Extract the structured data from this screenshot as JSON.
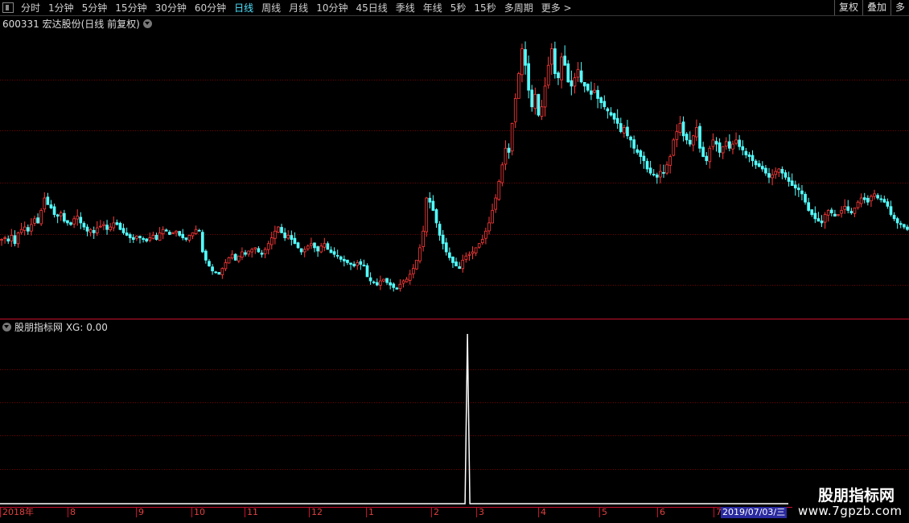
{
  "toolbar": {
    "periods": [
      "分时",
      "1分钟",
      "5分钟",
      "15分钟",
      "30分钟",
      "60分钟",
      "日线",
      "周线",
      "月线",
      "10分钟",
      "45日线",
      "季线",
      "年线",
      "5秒",
      "15秒",
      "多周期",
      "更多 >"
    ],
    "active_period": "日线",
    "right_buttons": [
      "复权",
      "叠加",
      "多"
    ]
  },
  "main_panel": {
    "title": "600331 宏达股份(日线 前复权)"
  },
  "indicator_panel": {
    "title": "股朋指标网 XG: 0.00"
  },
  "time_axis": {
    "labels": [
      "2018年",
      "8",
      "9",
      "10",
      "11",
      "12",
      "1",
      "2",
      "3",
      "4",
      "5",
      "6",
      "7"
    ],
    "current_date": "2019/07/03/三"
  },
  "watermark": {
    "line1": "股朋指标网",
    "line2": "www.7gpzb.com"
  },
  "colors": {
    "up": "#ff3a3a",
    "down": "#54ffff",
    "grid": "#7a0000",
    "divider": "#c8102e",
    "indicator": "#ffffff"
  },
  "chart_data": {
    "type": "candlestick",
    "closes": [
      3.1,
      3.12,
      3.08,
      3.15,
      3.05,
      3.18,
      3.22,
      3.25,
      3.2,
      3.28,
      3.35,
      3.3,
      3.45,
      3.6,
      3.52,
      3.48,
      3.4,
      3.38,
      3.42,
      3.32,
      3.3,
      3.28,
      3.35,
      3.38,
      3.3,
      3.25,
      3.2,
      3.22,
      3.18,
      3.24,
      3.26,
      3.28,
      3.22,
      3.25,
      3.3,
      3.28,
      3.22,
      3.18,
      3.15,
      3.12,
      3.1,
      3.14,
      3.12,
      3.1,
      3.08,
      3.12,
      3.15,
      3.1,
      3.18,
      3.22,
      3.2,
      3.16,
      3.18,
      3.2,
      3.15,
      3.12,
      3.1,
      3.15,
      3.18,
      3.22,
      3.2,
      2.95,
      2.85,
      2.78,
      2.72,
      2.7,
      2.68,
      2.75,
      2.82,
      2.88,
      2.92,
      2.85,
      2.9,
      2.95,
      2.92,
      2.96,
      2.98,
      3.0,
      2.95,
      2.92,
      2.98,
      3.05,
      3.12,
      3.2,
      3.25,
      3.18,
      3.12,
      3.15,
      3.1,
      3.05,
      3.0,
      2.95,
      2.98,
      3.02,
      3.05,
      3.0,
      2.96,
      3.02,
      3.05,
      2.98,
      2.94,
      2.92,
      2.9,
      2.86,
      2.84,
      2.82,
      2.8,
      2.78,
      2.82,
      2.8,
      2.78,
      2.65,
      2.6,
      2.58,
      2.55,
      2.6,
      2.62,
      2.58,
      2.55,
      2.52,
      2.5,
      2.56,
      2.6,
      2.62,
      2.68,
      2.75,
      2.85,
      3.0,
      3.2,
      3.6,
      3.55,
      3.45,
      3.3,
      3.15,
      3.05,
      2.95,
      2.88,
      2.82,
      2.78,
      2.75,
      2.85,
      2.9,
      2.92,
      2.95,
      3.0,
      3.05,
      3.1,
      3.2,
      3.3,
      3.45,
      3.6,
      3.8,
      4.0,
      4.2,
      4.15,
      4.5,
      4.8,
      5.1,
      5.4,
      5.2,
      4.9,
      4.7,
      4.85,
      4.6,
      4.7,
      4.95,
      5.2,
      5.4,
      5.1,
      5.05,
      5.3,
      5.2,
      5.0,
      4.95,
      5.05,
      5.15,
      5.0,
      4.95,
      4.9,
      4.85,
      4.9,
      4.8,
      4.75,
      4.7,
      4.65,
      4.6,
      4.55,
      4.5,
      4.4,
      4.45,
      4.35,
      4.3,
      4.2,
      4.15,
      4.1,
      4.05,
      3.95,
      3.9,
      3.88,
      3.85,
      3.92,
      3.9,
      4.0,
      4.1,
      4.3,
      4.4,
      4.5,
      4.35,
      4.3,
      4.25,
      4.35,
      4.45,
      4.2,
      4.1,
      4.05,
      4.2,
      4.3,
      4.25,
      4.15,
      4.22,
      4.28,
      4.2,
      4.25,
      4.3,
      4.22,
      4.18,
      4.12,
      4.1,
      4.05,
      4.0,
      3.98,
      3.95,
      3.9,
      3.85,
      3.88,
      3.92,
      3.95,
      3.9,
      3.85,
      3.8,
      3.75,
      3.72,
      3.7,
      3.65,
      3.55,
      3.45,
      3.4,
      3.35,
      3.32,
      3.3,
      3.4,
      3.45,
      3.42,
      3.38,
      3.4,
      3.45,
      3.5,
      3.45,
      3.42,
      3.48,
      3.55,
      3.6,
      3.58,
      3.55,
      3.62,
      3.65,
      3.6,
      3.58,
      3.55,
      3.5,
      3.4,
      3.35,
      3.3,
      3.28,
      3.25,
      3.22
    ],
    "signal": {
      "bar_index": 128,
      "value": 1
    }
  }
}
